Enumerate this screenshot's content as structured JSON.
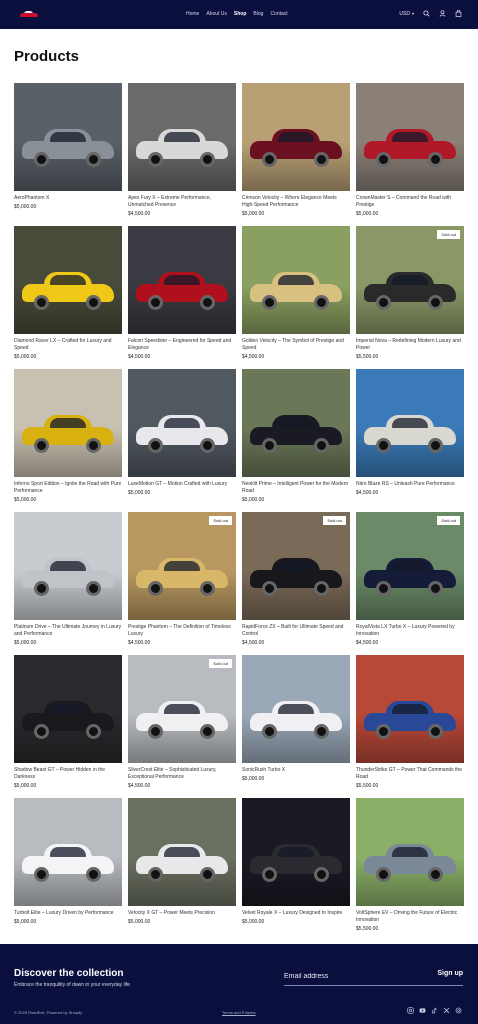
{
  "header": {
    "logo_icon": "car-logo-icon",
    "nav": [
      "Home",
      "About Us",
      "Shop",
      "Blog",
      "Contact"
    ],
    "active_nav": "Shop",
    "currency": "USD",
    "icons": [
      "search-icon",
      "account-icon",
      "cart-icon"
    ]
  },
  "page": {
    "title": "Products"
  },
  "products": [
    {
      "title": "AeroPhantom X",
      "price": "$5,000.00",
      "sold_out": false,
      "bg": "#5a6068",
      "car": "#8a9098"
    },
    {
      "title": "Apex Fury X – Extreme Performance, Unmatched Presence",
      "price": "$4,500.00",
      "sold_out": false,
      "bg": "#6a6a6a",
      "car": "#d8d8d8"
    },
    {
      "title": "Crimson Velocity – Where Elegance Meets High-Speed Performance",
      "price": "$5,000.00",
      "sold_out": false,
      "bg": "#b8a074",
      "car": "#6a1020"
    },
    {
      "title": "CrownMaster S – Command the Road with Prestige",
      "price": "$5,000.00",
      "sold_out": false,
      "bg": "#8a8078",
      "car": "#b01828"
    },
    {
      "title": "Diamond Racer LX – Crafted for Luxury and Speed",
      "price": "$5,000.00",
      "sold_out": false,
      "bg": "#4a4a3a",
      "car": "#f0c818"
    },
    {
      "title": "Falcon Speedster – Engineered for Speed and Elegance",
      "price": "$4,500.00",
      "sold_out": false,
      "bg": "#3a3a42",
      "car": "#b0101c"
    },
    {
      "title": "Golden Velocity – The Symbol of Prestige and Speed",
      "price": "$4,500.00",
      "sold_out": false,
      "bg": "#8aa060",
      "car": "#d8c080"
    },
    {
      "title": "Imperial Nova – Redefining Modern Luxury and Power",
      "price": "$5,500.00",
      "sold_out": true,
      "bg": "#8a9868",
      "car": "#2a2a2a"
    },
    {
      "title": "Inferno Sport Edition – Ignite the Road with Pure Performance",
      "price": "$5,000.00",
      "sold_out": false,
      "bg": "#c8c0b0",
      "car": "#d8b010"
    },
    {
      "title": "LuxeMotion GT – Motion Crafted with Luxury",
      "price": "$5,000.00",
      "sold_out": false,
      "bg": "#505860",
      "car": "#e8e8ec"
    },
    {
      "title": "Neoklit Prime – Intelligent Power for the Modern Road",
      "price": "$5,000.00",
      "sold_out": false,
      "bg": "#6a7858",
      "car": "#1a1a22"
    },
    {
      "title": "Nitro Blaze RS – Unleash Pure Performance",
      "price": "$4,500.00",
      "sold_out": false,
      "bg": "#3a7ab8",
      "car": "#d8d8d0"
    },
    {
      "title": "Platinum Drive – The Ultimate Journey in Luxury and Performance",
      "price": "$5,000.00",
      "sold_out": false,
      "bg": "#c8ccd0",
      "car": "#c0c4c8"
    },
    {
      "title": "Prestige Phantom – The Definition of Timeless Luxury",
      "price": "$4,500.00",
      "sold_out": true,
      "bg": "#b89860",
      "car": "#d8b868"
    },
    {
      "title": "RapidForce ZX – Built for Ultimate Speed and Control",
      "price": "$4,500.00",
      "sold_out": true,
      "bg": "#7a6a58",
      "car": "#18181c"
    },
    {
      "title": "RoyalVista LX Turbo X – Luxury Powered by Innovation",
      "price": "$4,500.00",
      "sold_out": true,
      "bg": "#6a8a68",
      "car": "#141c38"
    },
    {
      "title": "Shadow Beast GT – Power Hidden in the Darkness",
      "price": "$5,000.00",
      "sold_out": false,
      "bg": "#2a2a2e",
      "car": "#1a1a1e"
    },
    {
      "title": "SilverCrest Elite – Sophisticated Luxury, Exceptional Performance",
      "price": "$4,500.00",
      "sold_out": true,
      "bg": "#b8bcc0",
      "car": "#f0f0f2"
    },
    {
      "title": "SonicRush Turbo X",
      "price": "$5,000.00",
      "sold_out": false,
      "bg": "#9aa8b8",
      "car": "#f0f0f4"
    },
    {
      "title": "ThunderStrike GT – Power That Commands the Road",
      "price": "$5,500.00",
      "sold_out": false,
      "bg": "#b84838",
      "car": "#2a4898"
    },
    {
      "title": "Turbolt Elite – Luxury Driven by Performance",
      "price": "$5,000.00",
      "sold_out": false,
      "bg": "#b8bcc0",
      "car": "#f4f4f6"
    },
    {
      "title": "Velocity X GT – Power Meets Precision",
      "price": "$5,000.00",
      "sold_out": false,
      "bg": "#6a7060",
      "car": "#e8e8ea"
    },
    {
      "title": "Velvet Royale X – Luxury Designed to Inspire",
      "price": "$5,000.00",
      "sold_out": false,
      "bg": "#1a1a24",
      "car": "#2a2a30"
    },
    {
      "title": "VoltSphere EV – Driving the Future of Electric Innovation",
      "price": "$5,500.00",
      "sold_out": false,
      "bg": "#8ab068",
      "car": "#7a8898"
    }
  ],
  "labels": {
    "sold_out": "Sold out"
  },
  "footer": {
    "heading": "Discover the collection",
    "subtext": "Embrace the tranquility of dawn in your everyday life",
    "email_placeholder": "Email address",
    "signup": "Sign up",
    "copyright": "© 2025 RoadExit, Powered by Shopify",
    "terms": "Terms and Policies",
    "social": [
      "instagram-icon",
      "youtube-icon",
      "tiktok-icon",
      "x-icon",
      "threads-icon"
    ]
  },
  "colors": {
    "header_bg": "#0a0f3d",
    "footer_bg": "#0a0f3d",
    "accent": "#c8102e"
  }
}
